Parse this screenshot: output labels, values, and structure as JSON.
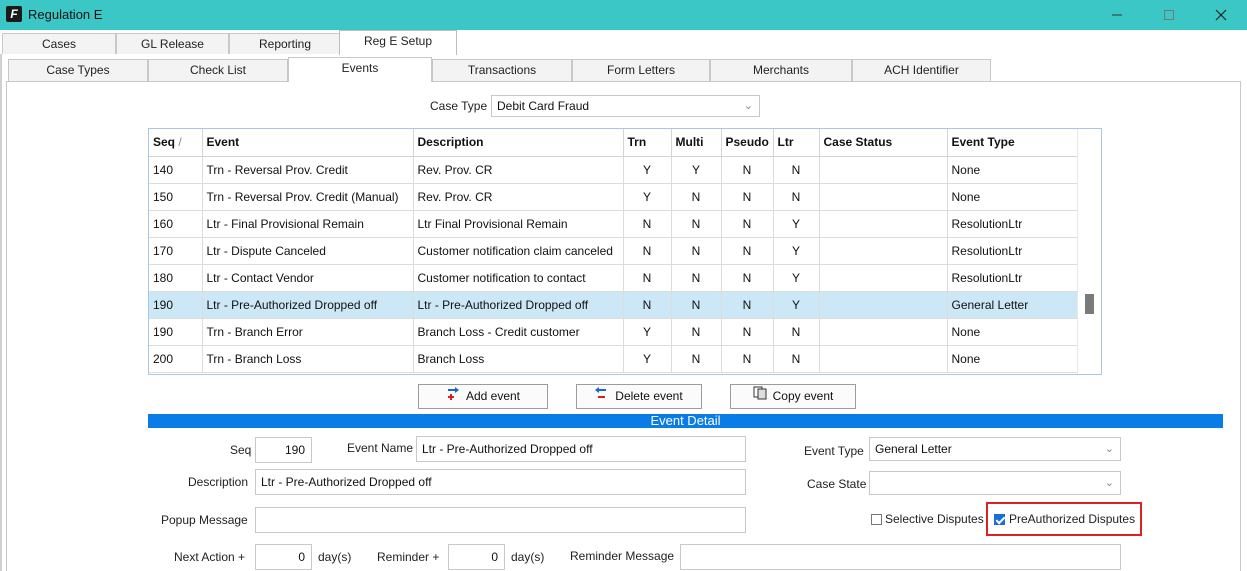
{
  "window": {
    "title": "Regulation E"
  },
  "main_tabs": [
    {
      "label": "Cases"
    },
    {
      "label": "GL Release"
    },
    {
      "label": "Reporting"
    },
    {
      "label": "Reg E Setup"
    }
  ],
  "sub_tabs": [
    {
      "label": "Case Types"
    },
    {
      "label": "Check List"
    },
    {
      "label": "Events"
    },
    {
      "label": "Transactions"
    },
    {
      "label": "Form Letters"
    },
    {
      "label": "Merchants"
    },
    {
      "label": "ACH Identifier"
    }
  ],
  "case_type": {
    "label": "Case Type",
    "value": "Debit Card Fraud"
  },
  "grid": {
    "columns": [
      "Seq",
      "Event",
      "Description",
      "Trn",
      "Multi",
      "Pseudo",
      "Ltr",
      "Case Status",
      "Event Type"
    ],
    "sort_marker": "/",
    "rows": [
      {
        "seq": "140",
        "event": "Trn - Reversal Prov. Credit",
        "description": "Rev. Prov. CR",
        "trn": "Y",
        "multi": "Y",
        "pseudo": "N",
        "ltr": "N",
        "case_status": "",
        "event_type": "None"
      },
      {
        "seq": "150",
        "event": "Trn - Reversal Prov. Credit (Manual)",
        "description": "Rev. Prov. CR",
        "trn": "Y",
        "multi": "N",
        "pseudo": "N",
        "ltr": "N",
        "case_status": "",
        "event_type": "None"
      },
      {
        "seq": "160",
        "event": "Ltr - Final Provisional Remain",
        "description": "Ltr Final Provisional Remain",
        "trn": "N",
        "multi": "N",
        "pseudo": "N",
        "ltr": "Y",
        "case_status": "",
        "event_type": "ResolutionLtr"
      },
      {
        "seq": "170",
        "event": "Ltr - Dispute Canceled",
        "description": "Customer notification claim canceled",
        "trn": "N",
        "multi": "N",
        "pseudo": "N",
        "ltr": "Y",
        "case_status": "",
        "event_type": "ResolutionLtr"
      },
      {
        "seq": "180",
        "event": "Ltr - Contact Vendor",
        "description": "Customer notification to contact",
        "trn": "N",
        "multi": "N",
        "pseudo": "N",
        "ltr": "Y",
        "case_status": "",
        "event_type": "ResolutionLtr"
      },
      {
        "seq": "190",
        "event": "Ltr - Pre-Authorized Dropped off",
        "description": "Ltr - Pre-Authorized Dropped off",
        "trn": "N",
        "multi": "N",
        "pseudo": "N",
        "ltr": "Y",
        "case_status": "",
        "event_type": "General Letter"
      },
      {
        "seq": "190",
        "event": "Trn - Branch Error",
        "description": "Branch Loss - Credit customer",
        "trn": "Y",
        "multi": "N",
        "pseudo": "N",
        "ltr": "N",
        "case_status": "",
        "event_type": "None"
      },
      {
        "seq": "200",
        "event": "Trn - Branch Loss",
        "description": "Branch Loss",
        "trn": "Y",
        "multi": "N",
        "pseudo": "N",
        "ltr": "N",
        "case_status": "",
        "event_type": "None"
      }
    ],
    "selected_row_index": 5,
    "scroll_position_fraction": 0.75
  },
  "buttons": {
    "add_event": "Add event",
    "delete_event": "Delete event",
    "copy_event": "Copy event"
  },
  "event_detail": {
    "header": "Event Detail",
    "seq_label": "Seq",
    "seq_value": "190",
    "event_name_label": "Event Name",
    "event_name_value": "Ltr - Pre-Authorized Dropped off",
    "event_type_label": "Event Type",
    "event_type_value": "General Letter",
    "description_label": "Description",
    "description_value": "Ltr - Pre-Authorized Dropped off",
    "case_state_label": "Case State",
    "case_state_value": "",
    "popup_message_label": "Popup Message",
    "popup_message_value": "",
    "selective_disputes_label": "Selective Disputes",
    "selective_disputes_checked": false,
    "preauthorized_disputes_label": "PreAuthorized Disputes",
    "preauthorized_disputes_checked": true,
    "next_action_label": "Next Action +",
    "next_action_value": "0",
    "days_label": "day(s)",
    "reminder_label": "Reminder +",
    "reminder_value": "0",
    "reminder_message_label": "Reminder Message",
    "reminder_message_value": ""
  },
  "colors": {
    "titlebar": "#3cc7c7",
    "selected_row": "#cce8f6",
    "detail_header": "#0a7ce6",
    "highlight_box": "#e02020",
    "checkbox_checked": "#1a6fd6"
  }
}
